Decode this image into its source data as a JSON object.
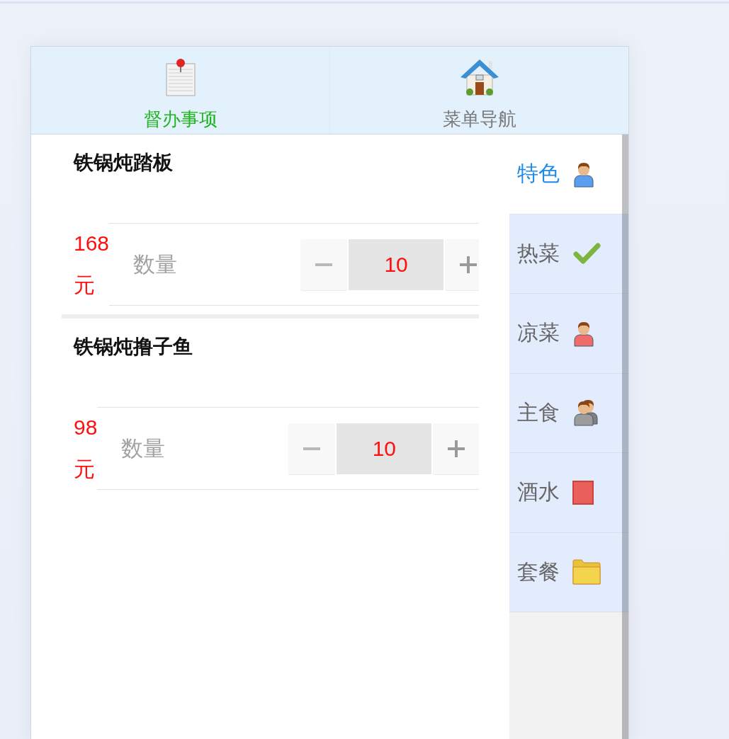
{
  "tabs": [
    {
      "label": "督办事项",
      "kind": "notepad",
      "selected": true
    },
    {
      "label": "菜单导航",
      "kind": "house",
      "selected": false
    }
  ],
  "dishes": [
    {
      "name": "铁锅炖踏板",
      "price": "168元",
      "quantity_label": "数量",
      "quantity": "10"
    },
    {
      "name": "铁锅炖撸子鱼",
      "price": "98元",
      "quantity_label": "数量",
      "quantity": "10"
    }
  ],
  "categories": [
    {
      "label": "特色",
      "kind": "person",
      "color": "#5b9ef0",
      "selected": true
    },
    {
      "label": "热菜",
      "kind": "tick",
      "color": "#7cb540",
      "selected": false
    },
    {
      "label": "凉菜",
      "kind": "person",
      "color": "#f06b6b",
      "selected": false
    },
    {
      "label": "主食",
      "kind": "people",
      "color": "#9c9c9c",
      "selected": false
    },
    {
      "label": "酒水",
      "kind": "square",
      "color": "#e9605a",
      "selected": false
    },
    {
      "label": "套餐",
      "kind": "folder",
      "color": "#f2d54c",
      "selected": false
    }
  ]
}
